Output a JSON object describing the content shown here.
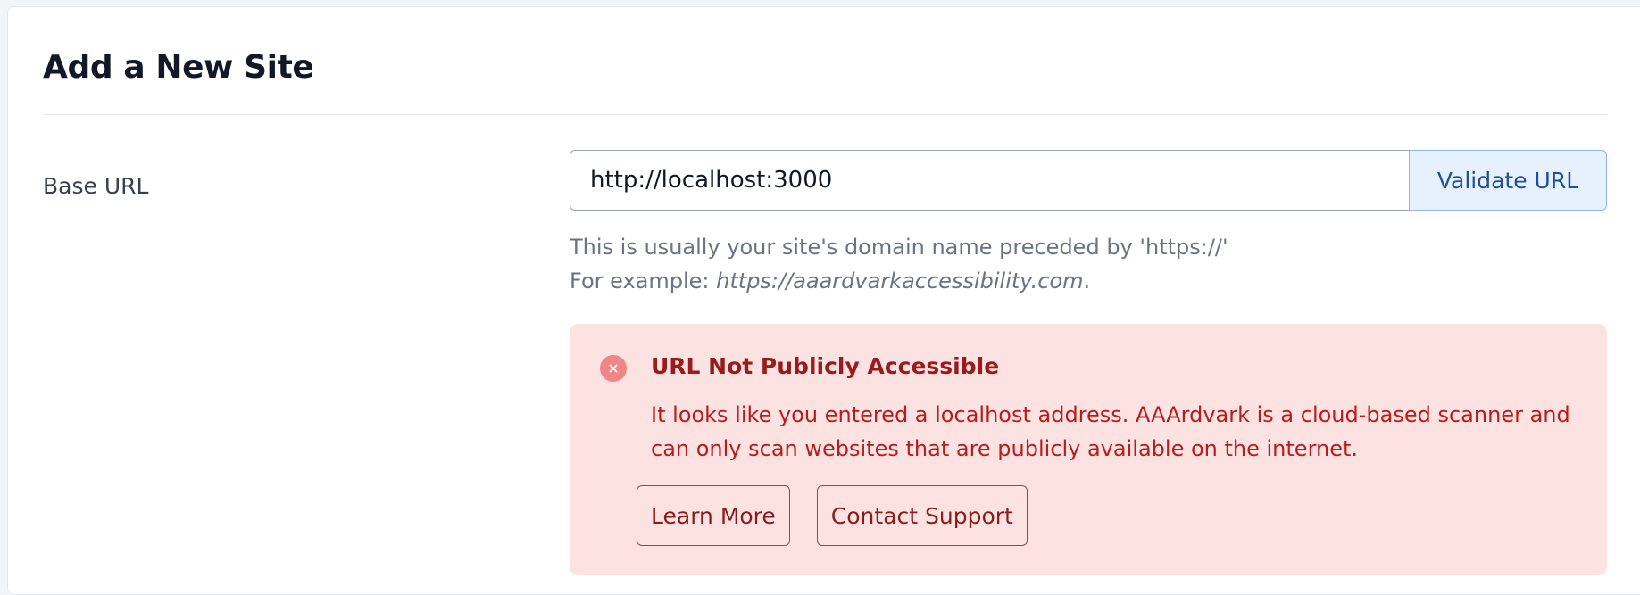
{
  "form": {
    "title": "Add a New Site",
    "base_url_label": "Base URL",
    "base_url_value": "http://localhost:3000",
    "validate_label": "Validate URL",
    "help_line1": "This is usually your site's domain name preceded by 'https://'",
    "help_example_prefix": "For example: ",
    "help_example_url": "https://aaardvarkaccessibility.com",
    "help_example_suffix": "."
  },
  "alert": {
    "icon": "x-circle-icon",
    "title": "URL Not Publicly Accessible",
    "message": "It looks like you entered a localhost address. AAArdvark is a cloud-based scanner and can only scan websites that are publicly available on the internet.",
    "learn_more_label": "Learn More",
    "contact_support_label": "Contact Support"
  },
  "colors": {
    "alert_background": "#fde2e2",
    "alert_text": "#b91c1c",
    "alert_title": "#991b1b",
    "validate_button_background": "#e7f0fd",
    "validate_button_text": "#1e4f9c"
  }
}
